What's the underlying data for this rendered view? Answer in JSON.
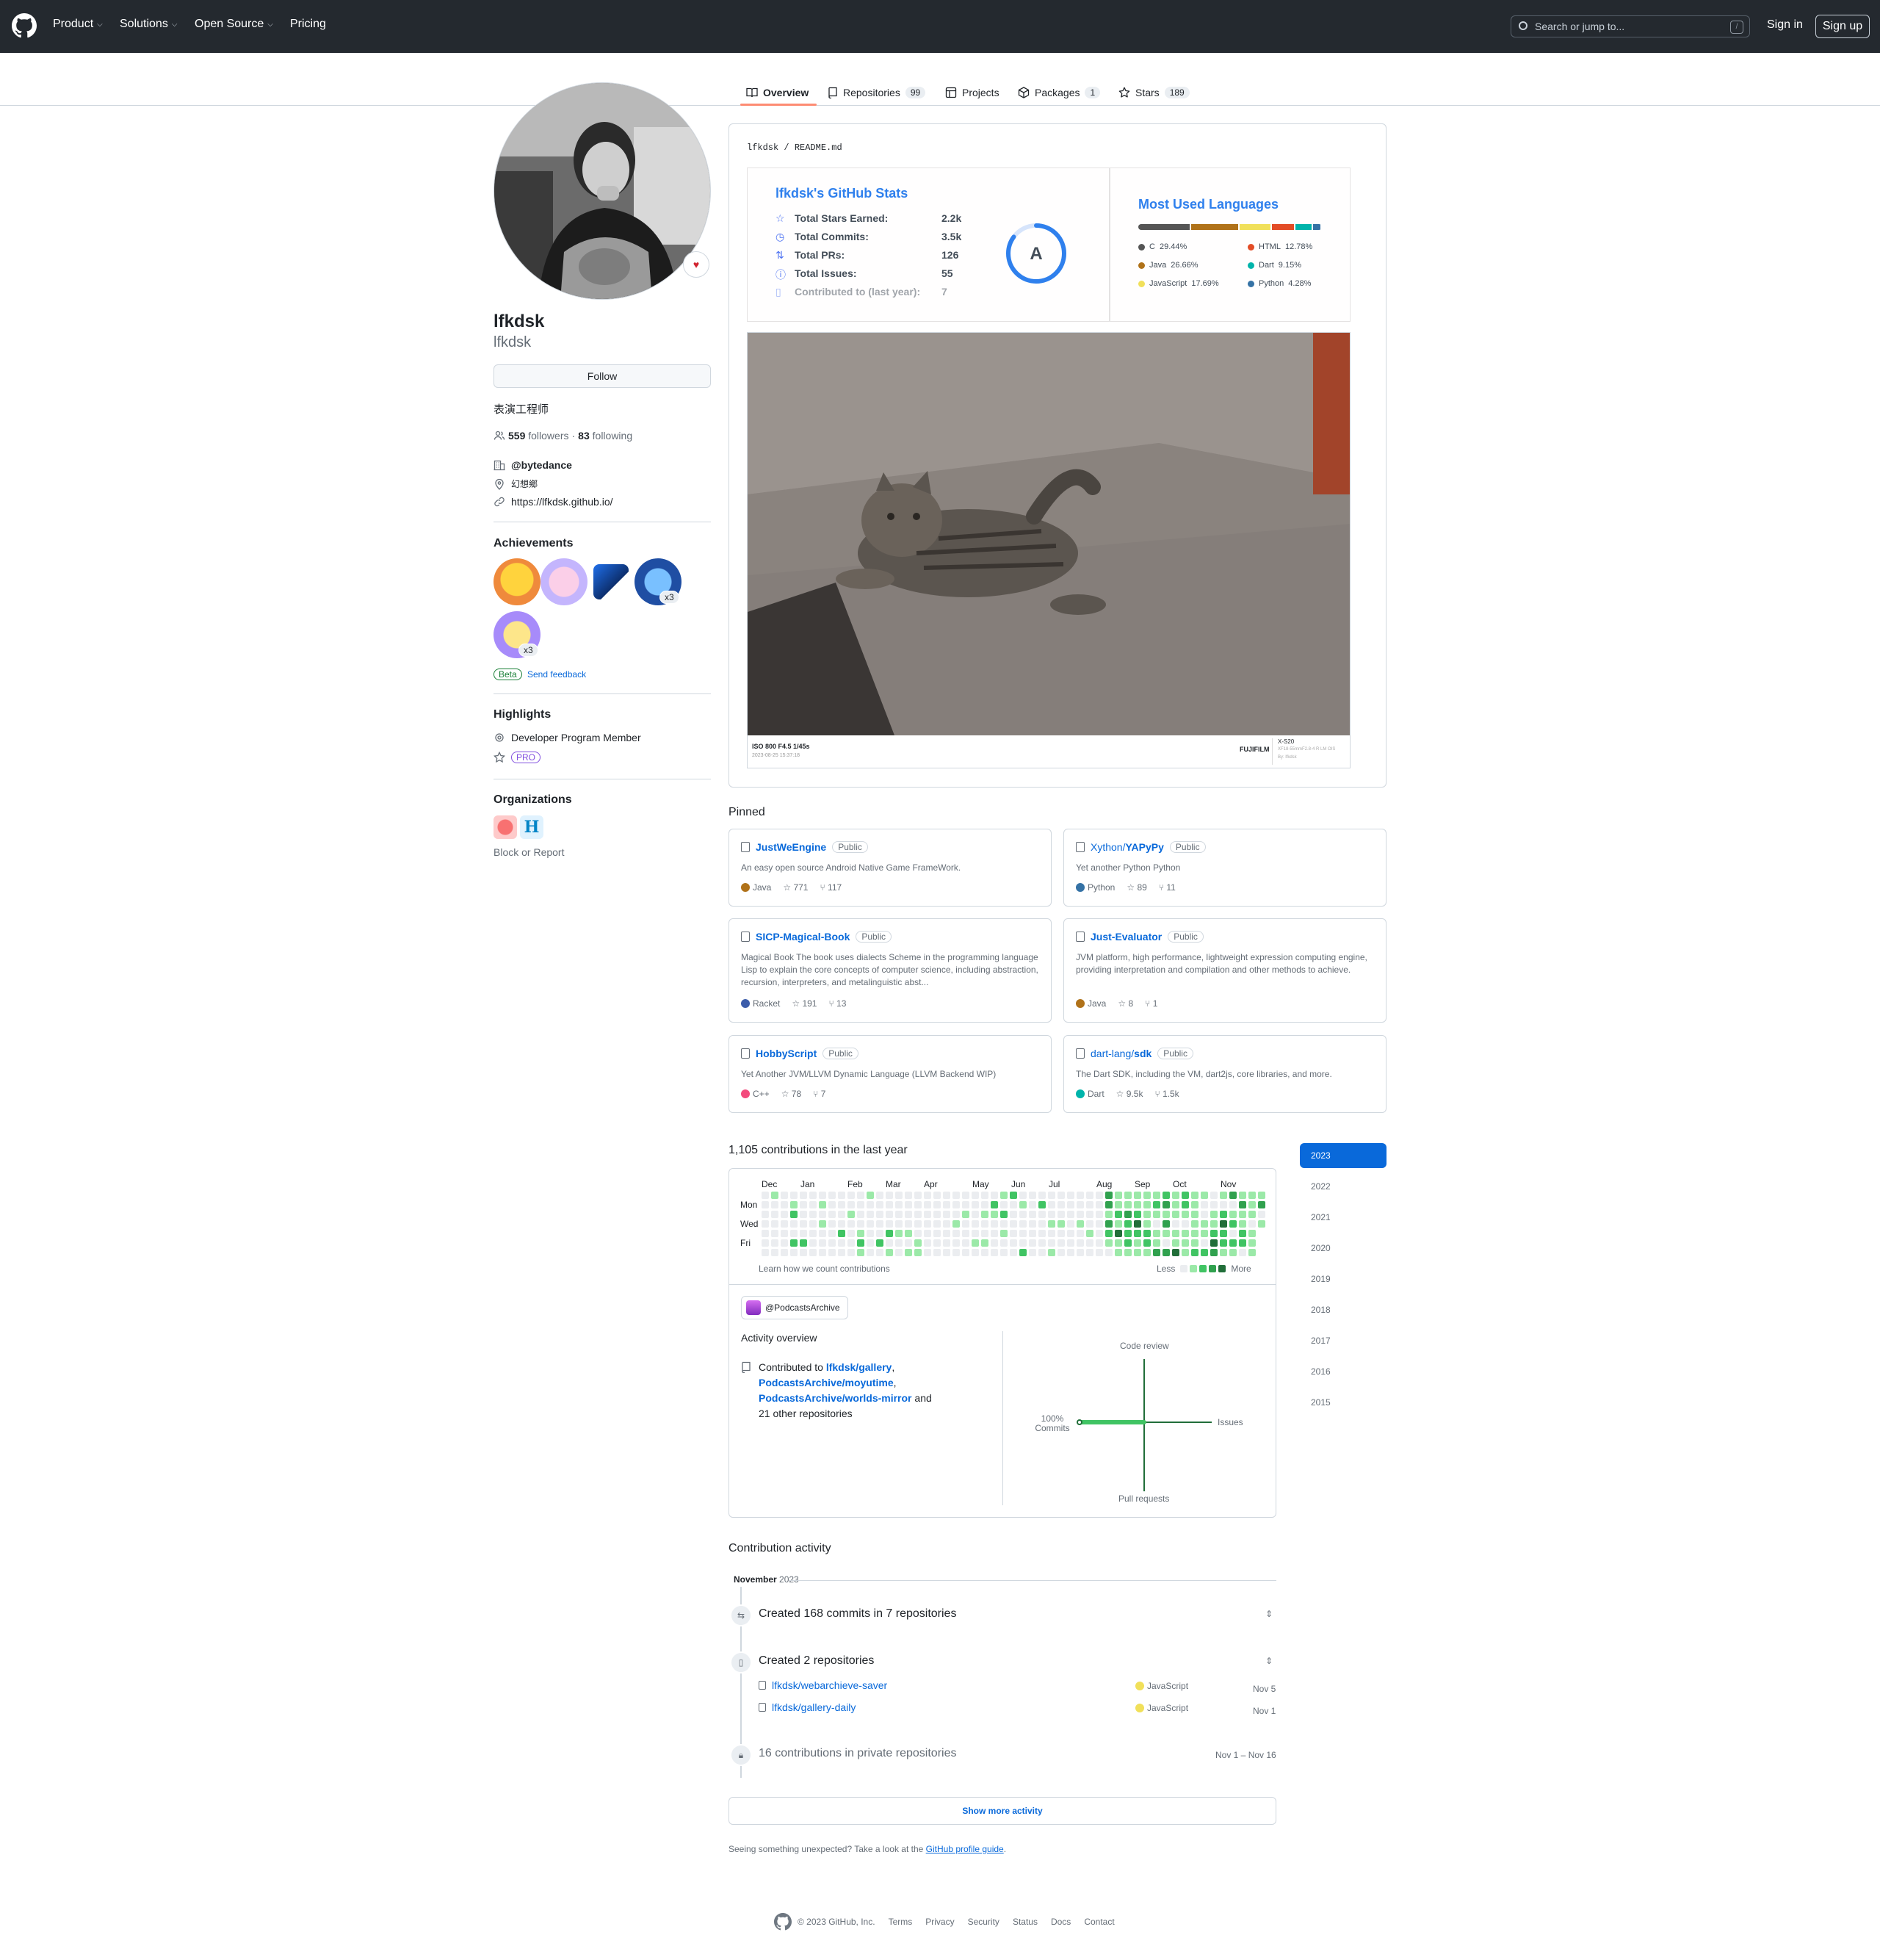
{
  "header": {
    "nav": [
      "Product",
      "Solutions",
      "Open Source",
      "Pricing"
    ],
    "search_placeholder": "Search or jump to...",
    "search_key": "/",
    "signin": "Sign in",
    "signup": "Sign up"
  },
  "tabs": [
    {
      "label": "Overview",
      "count": ""
    },
    {
      "label": "Repositories",
      "count": "99"
    },
    {
      "label": "Projects",
      "count": ""
    },
    {
      "label": "Packages",
      "count": "1"
    },
    {
      "label": "Stars",
      "count": "189"
    }
  ],
  "profile": {
    "name": "lfkdsk",
    "login": "lfkdsk",
    "follow_label": "Follow",
    "bio": "表演工程师",
    "followers": "559",
    "followers_label": "followers",
    "following": "83",
    "following_label": "following",
    "dot": "·",
    "company": "@bytedance",
    "location": "幻想鄉",
    "website": "https://lfkdsk.github.io/"
  },
  "achievements": {
    "heading": "Achievements",
    "counts": [
      "x3",
      "x3"
    ],
    "beta": "Beta",
    "feedback": "Send feedback"
  },
  "highlights": {
    "heading": "Highlights",
    "item": "Developer Program Member",
    "pro": "PRO"
  },
  "organizations": {
    "heading": "Organizations",
    "block": "Block or Report"
  },
  "readme": {
    "path_user": "lfkdsk",
    "path_sep": "/",
    "path_file": "README.md",
    "stats": {
      "title": "lfkdsk's GitHub Stats",
      "rows": [
        {
          "label": "Total Stars Earned:",
          "value": "2.2k"
        },
        {
          "label": "Total Commits:",
          "value": "3.5k"
        },
        {
          "label": "Total PRs:",
          "value": "126"
        },
        {
          "label": "Total Issues:",
          "value": "55"
        },
        {
          "label": "Contributed to (last year):",
          "value": "7"
        }
      ],
      "rank": "A",
      "rank_progress": 0.85
    },
    "languages": {
      "title": "Most Used Languages",
      "items": [
        {
          "name": "C",
          "pct": "29.44%",
          "value": 29.44,
          "color": "#555555"
        },
        {
          "name": "HTML",
          "pct": "12.78%",
          "value": 12.78,
          "color": "#e34c26"
        },
        {
          "name": "Java",
          "pct": "26.66%",
          "value": 26.66,
          "color": "#b07219"
        },
        {
          "name": "Dart",
          "pct": "9.15%",
          "value": 9.15,
          "color": "#00b4ab"
        },
        {
          "name": "JavaScript",
          "pct": "17.69%",
          "value": 17.69,
          "color": "#f1e05a"
        },
        {
          "name": "Python",
          "pct": "4.28%",
          "value": 4.28,
          "color": "#3572a5"
        }
      ]
    },
    "photo": {
      "exif": "ISO 800 F4.5 1/45s",
      "date": "2023-08-25 15:37:18",
      "brand": "FUJIFILM",
      "model": "X-S20",
      "lens": "XF18-55mmF2.8-4 R LM OIS",
      "by": "By: lfkdsk"
    }
  },
  "pinned": {
    "heading": "Pinned",
    "public_label": "Public",
    "items": [
      {
        "owner": "",
        "name": "JustWeEngine",
        "desc": "An easy open source Android Native Game FrameWork.",
        "lang": "Java",
        "lang_color": "#b07219",
        "stars": "771",
        "forks": "117"
      },
      {
        "owner": "Xython/",
        "name": "YAPyPy",
        "desc": "Yet another Python Python",
        "lang": "Python",
        "lang_color": "#3572a5",
        "stars": "89",
        "forks": "11"
      },
      {
        "owner": "",
        "name": "SICP-Magical-Book",
        "desc": "Magical Book The book uses dialects Scheme in the programming language Lisp to explain the core concepts of computer science, including abstraction, recursion, interpreters, and metalinguistic abst...",
        "lang": "Racket",
        "lang_color": "#3c5caa",
        "stars": "191",
        "forks": "13"
      },
      {
        "owner": "",
        "name": "Just-Evaluator",
        "desc": "JVM platform, high performance, lightweight expression computing engine, providing interpretation and compilation and other methods to achieve.",
        "lang": "Java",
        "lang_color": "#b07219",
        "stars": "8",
        "forks": "1"
      },
      {
        "owner": "",
        "name": "HobbyScript",
        "desc": "Yet Another JVM/LLVM Dynamic Language (LLVM Backend WIP)",
        "lang": "C++",
        "lang_color": "#f34b7d",
        "stars": "78",
        "forks": "7"
      },
      {
        "owner": "dart-lang/",
        "name": "sdk",
        "desc": "The Dart SDK, including the VM, dart2js, core libraries, and more.",
        "lang": "Dart",
        "lang_color": "#00b4ab",
        "stars": "9.5k",
        "forks": "1.5k"
      }
    ]
  },
  "contributions": {
    "heading": "1,105 contributions in the last year",
    "months": [
      "Dec",
      "Jan",
      "Feb",
      "Mar",
      "Apr",
      "May",
      "Jun",
      "Jul",
      "Aug",
      "Sep",
      "Oct",
      "Nov"
    ],
    "days": [
      "Mon",
      "Wed",
      "Fri"
    ],
    "learn": "Learn how we count contributions",
    "less": "Less",
    "more": "More",
    "org": "@PodcastsArchive",
    "activity_overview": "Activity overview",
    "contributed_to": "Contributed to",
    "repos": [
      "lfkdsk/gallery",
      "PodcastsArchive/moyutime",
      "PodcastsArchive/worlds-mirror"
    ],
    "others": "and 21 other repositories",
    "axes": {
      "code_review": "Code review",
      "issues": "Issues",
      "pull_requests": "Pull requests",
      "commits_pct": "100%",
      "commits": "Commits"
    },
    "commits_share": 100
  },
  "years": [
    "2023",
    "2022",
    "2021",
    "2020",
    "2019",
    "2018",
    "2017",
    "2016",
    "2015"
  ],
  "activity": {
    "heading": "Contribution activity",
    "month": "November",
    "year": "2023",
    "commits": "Created 168 commits in 7 repositories",
    "created": "Created 2 repositories",
    "new_repos": [
      {
        "name": "lfkdsk/webarchieve-saver",
        "lang": "JavaScript",
        "date": "Nov 5"
      },
      {
        "name": "lfkdsk/gallery-daily",
        "lang": "JavaScript",
        "date": "Nov 1"
      }
    ],
    "private": "16 contributions in private repositories",
    "private_range": "Nov 1 – Nov 16",
    "show_more": "Show more activity",
    "unexpected": "Seeing something unexpected? Take a look at the",
    "guide": "GitHub profile guide",
    "period": "."
  },
  "footer": {
    "copyright": "© 2023 GitHub, Inc.",
    "links": [
      "Terms",
      "Privacy",
      "Security",
      "Status",
      "Docs",
      "Contact"
    ]
  }
}
